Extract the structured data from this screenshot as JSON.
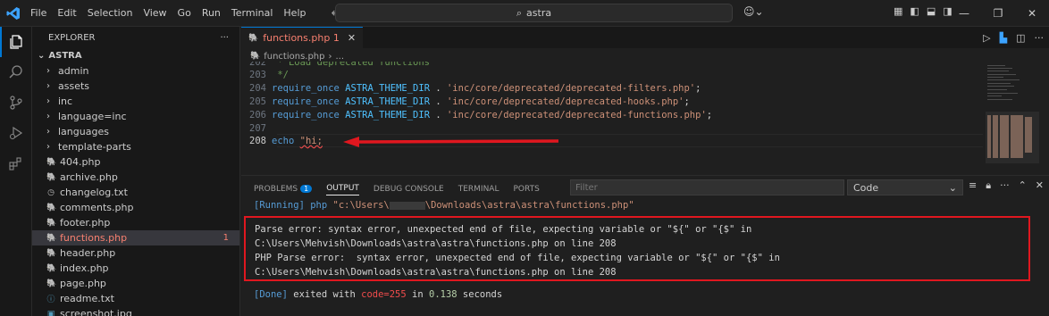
{
  "titlebar": {
    "menu": [
      "File",
      "Edit",
      "Selection",
      "View",
      "Go",
      "Run",
      "Terminal",
      "Help"
    ],
    "search_text": "astra",
    "window_controls": [
      "—",
      "❐",
      "✕"
    ]
  },
  "activity": {
    "icons": [
      "explorer-icon",
      "search-icon",
      "source-control-icon",
      "run-debug-icon",
      "extensions-icon"
    ]
  },
  "sidebar": {
    "title": "EXPLORER",
    "more": "···",
    "root": "ASTRA",
    "folders": [
      "admin",
      "assets",
      "inc",
      "language=inc",
      "languages",
      "template-parts"
    ],
    "files": [
      {
        "name": "404.php",
        "icon": "php-icon"
      },
      {
        "name": "archive.php",
        "icon": "php-icon"
      },
      {
        "name": "changelog.txt",
        "icon": "clock-icon"
      },
      {
        "name": "comments.php",
        "icon": "php-icon"
      },
      {
        "name": "footer.php",
        "icon": "php-icon"
      },
      {
        "name": "functions.php",
        "icon": "php-icon",
        "badge": "1",
        "selected": true
      },
      {
        "name": "header.php",
        "icon": "php-icon"
      },
      {
        "name": "index.php",
        "icon": "php-icon"
      },
      {
        "name": "page.php",
        "icon": "php-icon"
      },
      {
        "name": "readme.txt",
        "icon": "info-icon"
      },
      {
        "name": "screenshot.jpg",
        "icon": "image-icon"
      }
    ]
  },
  "editor": {
    "tab_label": "functions.php 1",
    "tab_close": "✕",
    "breadcrumb_file": "functions.php",
    "breadcrumb_more": "...",
    "lines": {
      "l203_num": "203",
      "l203_text": " */",
      "l204_num": "204",
      "l204_kw": "require_once",
      "l204_const": "ASTRA_THEME_DIR",
      "l204_dot": " . ",
      "l204_str": "'inc/core/deprecated/deprecated-filters.php'",
      "l204_end": ";",
      "l205_num": "205",
      "l205_kw": "require_once",
      "l205_const": "ASTRA_THEME_DIR",
      "l205_dot": " . ",
      "l205_str": "'inc/core/deprecated/deprecated-hooks.php'",
      "l205_end": ";",
      "l206_num": "206",
      "l206_kw": "require_once",
      "l206_const": "ASTRA_THEME_DIR",
      "l206_dot": " . ",
      "l206_str": "'inc/core/deprecated/deprecated-functions.php'",
      "l206_end": ";",
      "l207_num": "207",
      "l208_num": "208",
      "l208_kw": "echo",
      "l208_str": "\"hi;"
    },
    "annotation_color": "#e0171f"
  },
  "panel": {
    "tabs": [
      "PROBLEMS",
      "OUTPUT",
      "DEBUG CONSOLE",
      "TERMINAL",
      "PORTS"
    ],
    "problems_count": "1",
    "filter_placeholder": "Filter",
    "channel": "Code",
    "running_tag": "[Running]",
    "running_cmd": "php",
    "running_path_a": "\"c:\\Users\\",
    "running_path_b": "\\Downloads\\astra\\astra\\functions.php\"",
    "error_1": "Parse error: syntax error, unexpected end of file, expecting variable or \"${\" or \"{$\" in C:\\Users\\Mehvish\\Downloads\\astra\\astra\\functions.php on line 208",
    "error_2": "PHP Parse error:  syntax error, unexpected end of file, expecting variable or \"${\" or \"{$\" in C:\\Users\\Mehvish\\Downloads\\astra\\astra\\functions.php on line 208",
    "done_tag": "[Done]",
    "done_text_a": " exited with ",
    "done_code": "code=255",
    "done_text_b": " in ",
    "done_time": "0.138",
    "done_text_c": " seconds"
  }
}
